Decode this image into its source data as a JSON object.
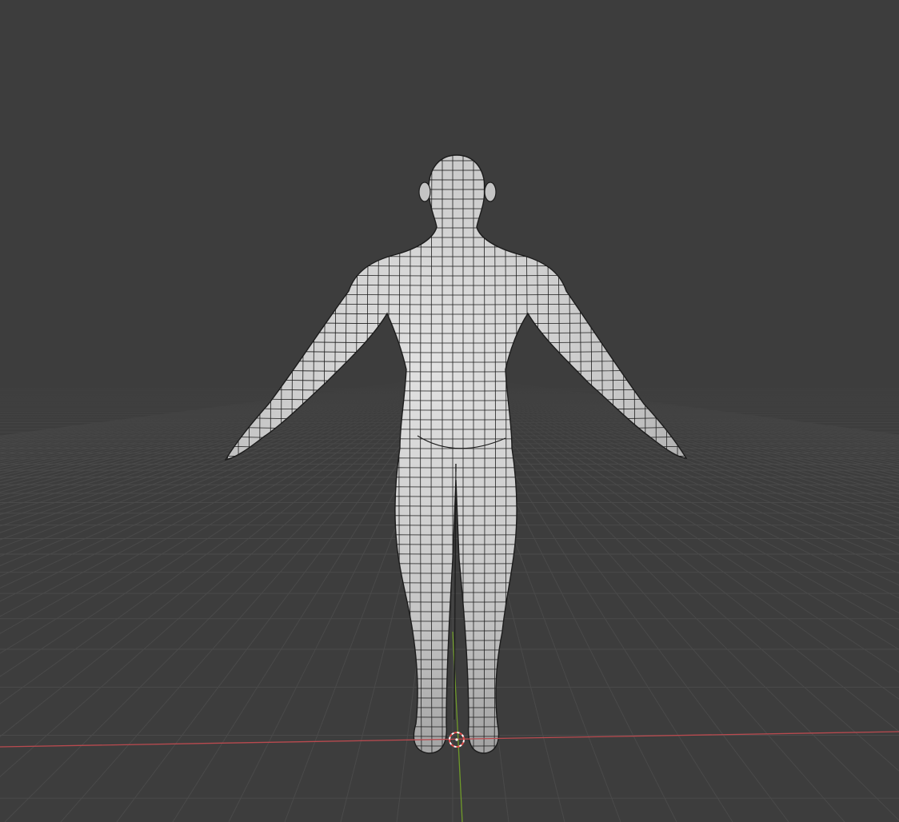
{
  "viewport": {
    "view": "back-orthographic-perspective",
    "shading": "solid",
    "overlay": "wireframe",
    "background_color": "#3d3d3d",
    "grid_color": "#4a4a4a",
    "x_axis_color": "#b94a4f",
    "y_axis_color": "#6f9a2a",
    "mesh_fill_color": "#c9c9c9",
    "wire_color": "#1c1c1c",
    "cursor_colors": [
      "#e24b4b",
      "#ffffff"
    ]
  },
  "scene": {
    "object": "humanoid-base-mesh",
    "pose": "A-pose",
    "origin_marker": "3d-cursor-icon"
  }
}
